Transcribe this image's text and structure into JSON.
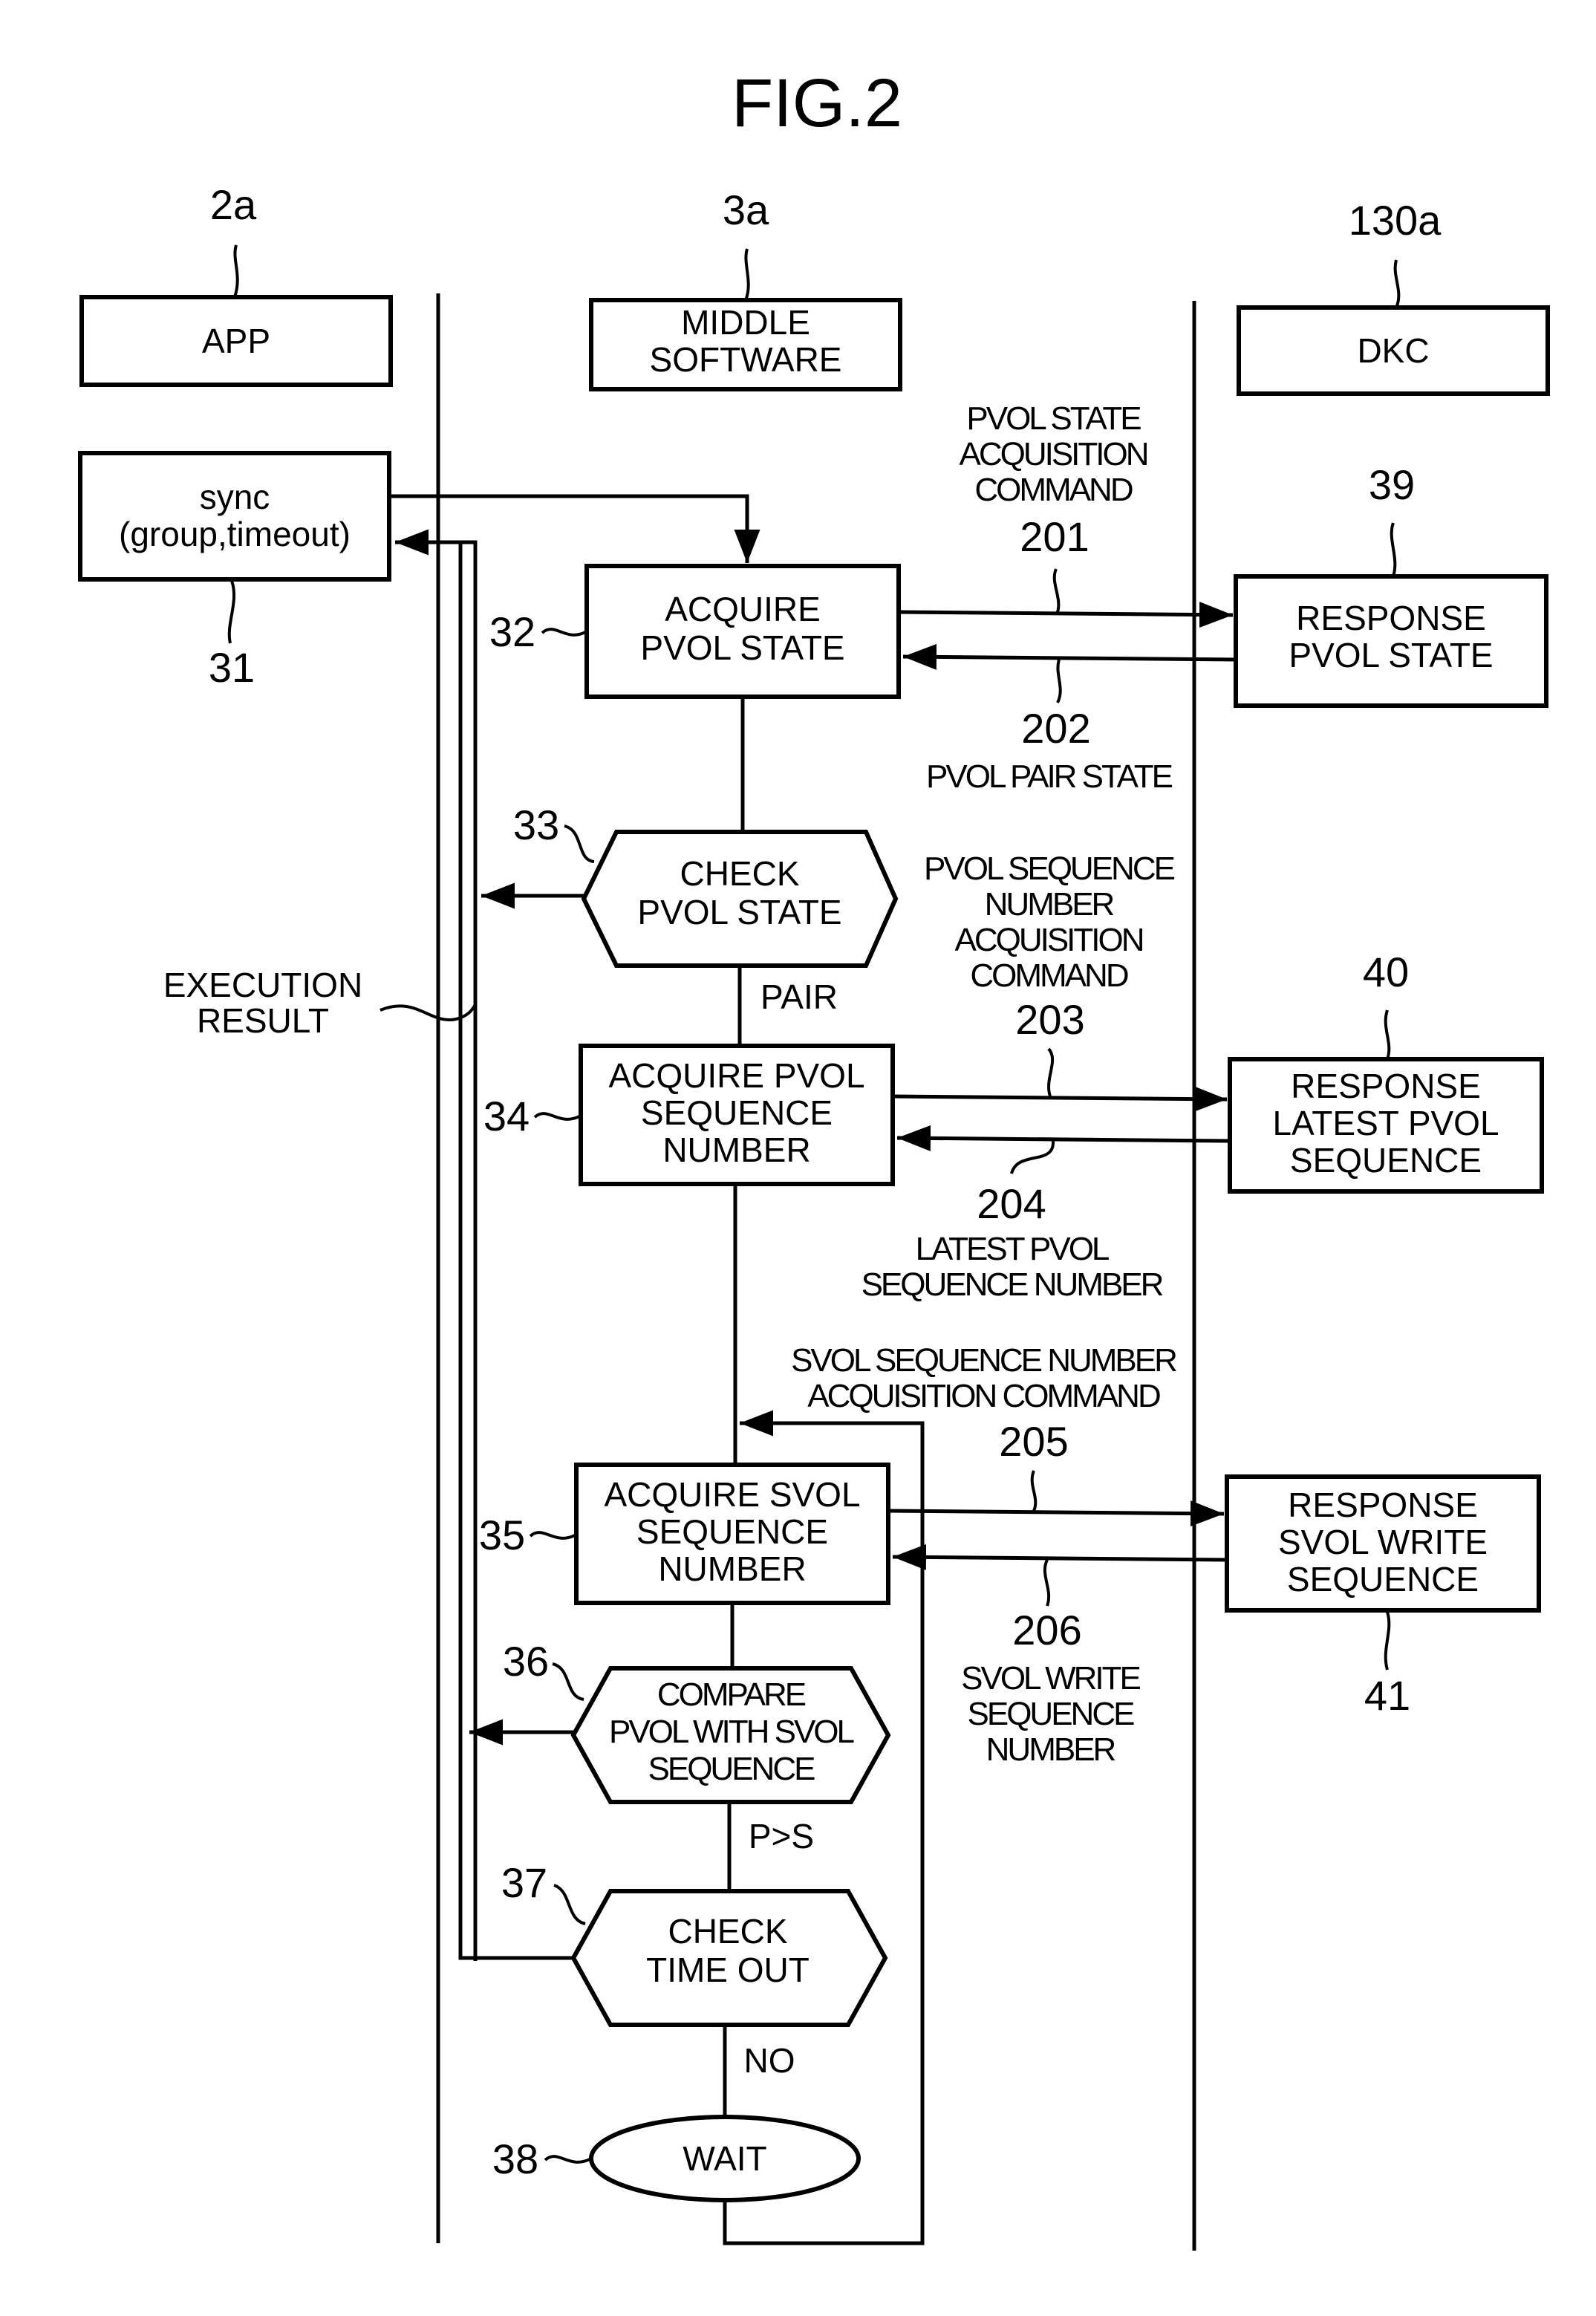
{
  "figure": {
    "title": "FIG.2"
  },
  "columns": [
    {
      "ref": "2a",
      "label": "APP"
    },
    {
      "ref": "3a",
      "label_lines": [
        "MIDDLE",
        "SOFTWARE"
      ]
    },
    {
      "ref": "130a",
      "label": "DKC"
    }
  ],
  "app": {
    "sync": {
      "ref": "31",
      "lines": [
        "sync",
        "(group,timeout)"
      ]
    },
    "execution_result": [
      "EXECUTION",
      "RESULT"
    ]
  },
  "steps": {
    "s32": {
      "ref": "32",
      "lines": [
        "ACQUIRE",
        "PVOL STATE"
      ]
    },
    "s33": {
      "ref": "33",
      "lines": [
        "CHECK",
        "PVOL STATE"
      ],
      "branch": "PAIR"
    },
    "s34": {
      "ref": "34",
      "lines": [
        "ACQUIRE PVOL",
        "SEQUENCE",
        "NUMBER"
      ]
    },
    "s35": {
      "ref": "35",
      "lines": [
        "ACQUIRE SVOL",
        "SEQUENCE",
        "NUMBER"
      ]
    },
    "s36": {
      "ref": "36",
      "lines": [
        "COMPARE",
        "PVOL WITH SVOL",
        "SEQUENCE"
      ],
      "branch": "P>S"
    },
    "s37": {
      "ref": "37",
      "lines": [
        "CHECK",
        "TIME OUT"
      ],
      "branch": "NO"
    },
    "s38": {
      "ref": "38",
      "label": "WAIT"
    }
  },
  "dkc": {
    "r39": {
      "ref": "39",
      "lines": [
        "RESPONSE",
        "PVOL STATE"
      ]
    },
    "r40": {
      "ref": "40",
      "lines": [
        "RESPONSE",
        "LATEST PVOL",
        "SEQUENCE"
      ]
    },
    "r41": {
      "ref": "41",
      "lines": [
        "RESPONSE",
        "SVOL WRITE",
        "SEQUENCE"
      ]
    }
  },
  "messages": {
    "m201": {
      "ref": "201",
      "lines": [
        "PVOL STATE",
        "ACQUISITION",
        "COMMAND"
      ]
    },
    "m202": {
      "ref": "202",
      "lines": [
        "PVOL PAIR STATE"
      ]
    },
    "m203": {
      "ref": "203",
      "lines": [
        "PVOL SEQUENCE",
        "NUMBER",
        "ACQUISITION",
        "COMMAND"
      ]
    },
    "m204": {
      "ref": "204",
      "lines": [
        "LATEST PVOL",
        "SEQUENCE NUMBER"
      ]
    },
    "m205": {
      "ref": "205",
      "lines": [
        "SVOL SEQUENCE NUMBER",
        "ACQUISITION COMMAND"
      ]
    },
    "m206": {
      "ref": "206",
      "lines": [
        "SVOL WRITE",
        "SEQUENCE",
        "NUMBER"
      ]
    }
  }
}
